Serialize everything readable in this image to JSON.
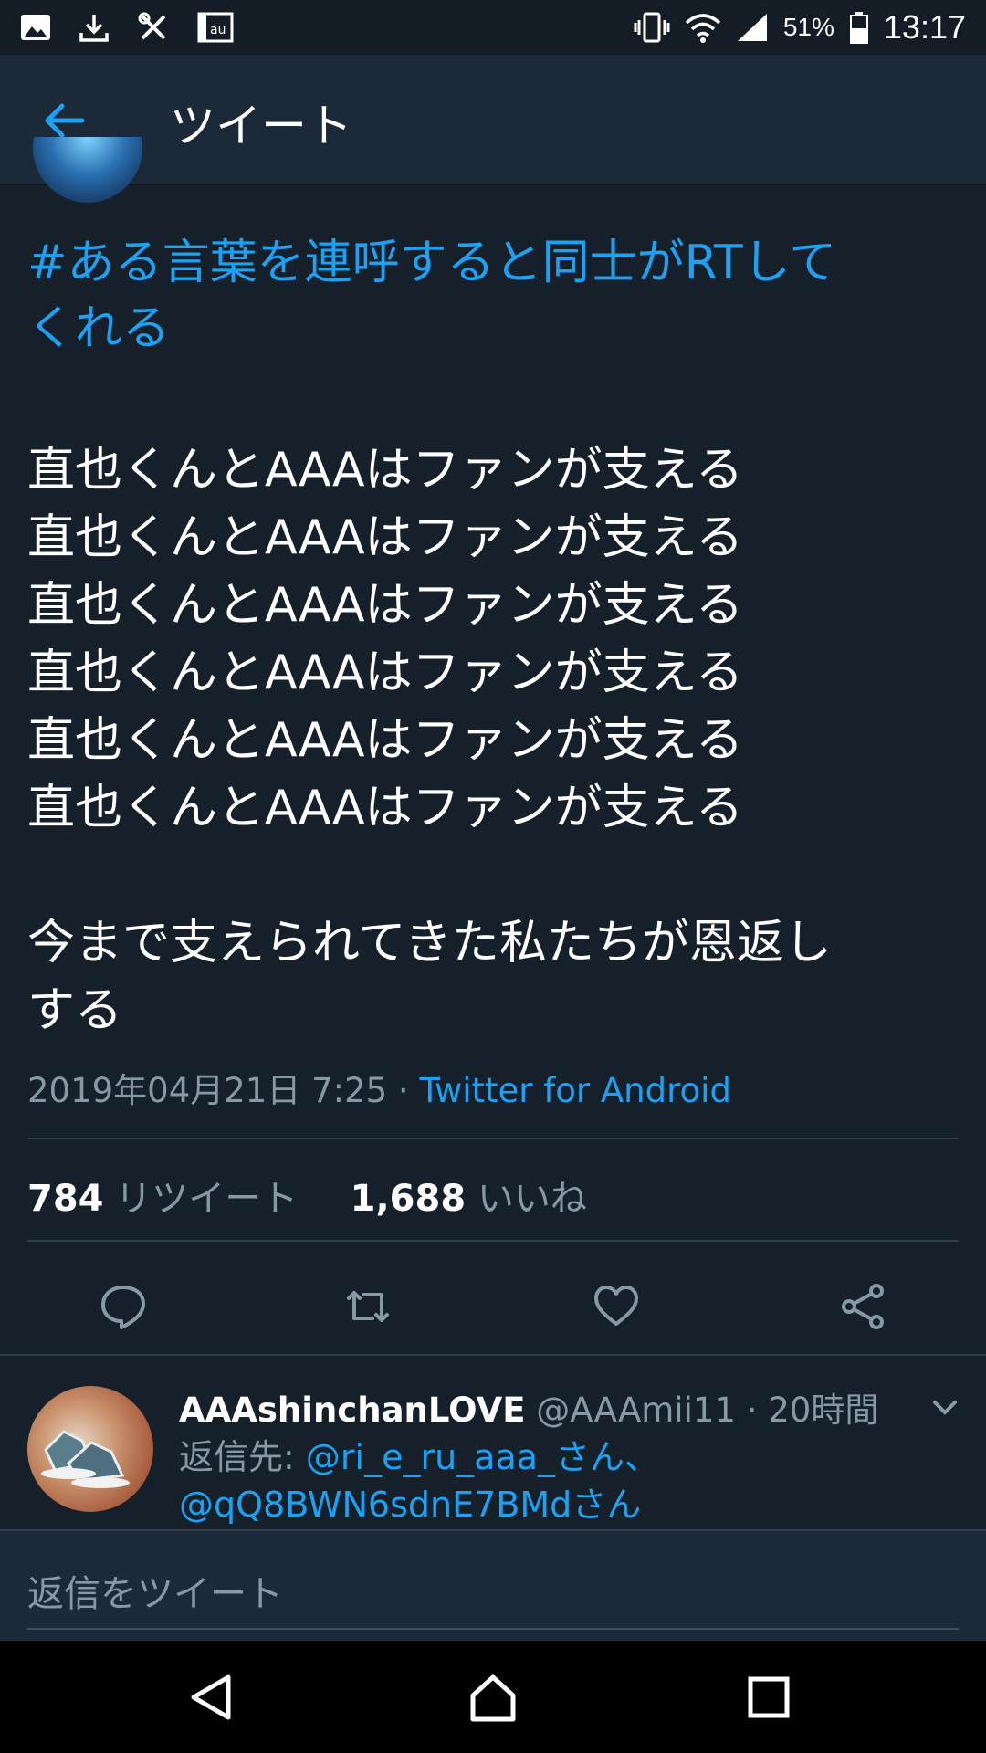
{
  "status_bar": {
    "battery": "51%",
    "time": "13:17",
    "left_icons": [
      "image-icon",
      "download-icon",
      "tools-icon",
      "au-icon"
    ],
    "right_icons": [
      "vibrate-icon",
      "wifi-icon",
      "signal-icon",
      "battery-icon"
    ]
  },
  "header": {
    "title": "ツイート"
  },
  "tweet": {
    "hashtag_line1": "#ある言葉を連呼すると同士がRTして",
    "hashtag_line2": "くれる",
    "lines": [
      "直也くんとAAAはファンが支える",
      "直也くんとAAAはファンが支える",
      "直也くんとAAAはファンが支える",
      "直也くんとAAAはファンが支える",
      "直也くんとAAAはファンが支える",
      "直也くんとAAAはファンが支える"
    ],
    "closing_line1": "今まで支えられてきた私たちが恩返し",
    "closing_line2": "する",
    "timestamp": "2019年04月21日 7:25 · ",
    "source": "Twitter for Android",
    "retweets": "784",
    "retweets_label": " リツイート",
    "likes": "1,688",
    "likes_label": " いいね"
  },
  "reply": {
    "name": "AAAshinchanLOVE",
    "handle_time": " @AAAmii11 · 20時間",
    "reply_label": "返信先: ",
    "reply_user1": "@ri_e_ru_aaa_さん、",
    "reply_user2": "@qQ8BWN6sdnE7BMdさん"
  },
  "composer": {
    "placeholder": "返信をツイート"
  },
  "colors": {
    "background": "#15202b",
    "header": "#1c2938",
    "accent": "#1da1f2",
    "secondary_text": "#8899a6"
  }
}
